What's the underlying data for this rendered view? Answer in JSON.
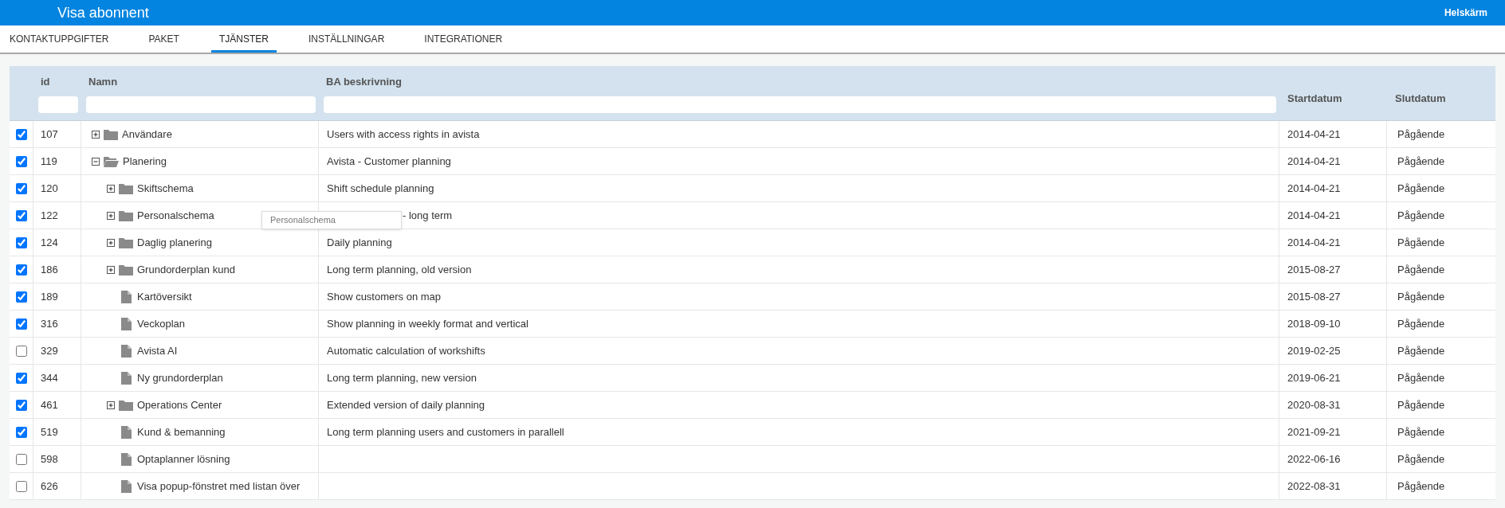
{
  "window": {
    "title": "Visa abonnent",
    "fullscreen_link": "Helskärm"
  },
  "tabs": [
    {
      "label": "KONTAKTUPPGIFTER",
      "selected": false
    },
    {
      "label": "PAKET",
      "selected": false
    },
    {
      "label": "TJÄNSTER",
      "selected": true
    },
    {
      "label": "INSTÄLLNINGAR",
      "selected": false
    },
    {
      "label": "INTEGRATIONER",
      "selected": false
    }
  ],
  "table": {
    "columns": [
      {
        "label": "id",
        "filter": true
      },
      {
        "label": "Namn",
        "filter": true
      },
      {
        "label": "BA beskrivning",
        "filter": true
      },
      {
        "label": "Startdatum",
        "filter": false
      },
      {
        "label": "Slutdatum",
        "filter": false
      }
    ],
    "rows": [
      {
        "checked": true,
        "id": "107",
        "name": "Användare",
        "kind": "folder",
        "expanded": false,
        "description": "Users with access rights in avista",
        "start": "2014-04-21",
        "end": "Pågående"
      },
      {
        "checked": true,
        "id": "119",
        "name": "Planering",
        "kind": "folder",
        "expanded": true,
        "description": "Avista - Customer planning",
        "start": "2014-04-21",
        "end": "Pågående",
        "children": [
          {
            "checked": true,
            "id": "120",
            "name": "Skiftschema",
            "kind": "folder",
            "expanded": false,
            "description": "Shift schedule planning",
            "start": "2014-04-21",
            "end": "Pågående"
          },
          {
            "checked": true,
            "id": "122",
            "name": "Personalschema",
            "kind": "folder",
            "expanded": false,
            "description": "- long term",
            "tooltip": "Personalschema",
            "start": "2014-04-21",
            "end": "Pågående"
          },
          {
            "checked": true,
            "id": "124",
            "name": "Daglig planering",
            "kind": "folder",
            "expanded": false,
            "description": "Daily planning",
            "start": "2014-04-21",
            "end": "Pågående"
          },
          {
            "checked": true,
            "id": "186",
            "name": "Grundorderplan kund",
            "kind": "folder",
            "expanded": false,
            "description": "Long term planning, old version",
            "start": "2015-08-27",
            "end": "Pågående"
          },
          {
            "checked": true,
            "id": "189",
            "name": "Kartöversikt",
            "kind": "document",
            "description": "Show customers on map",
            "start": "2015-08-27",
            "end": "Pågående"
          },
          {
            "checked": true,
            "id": "316",
            "name": "Veckoplan",
            "kind": "document",
            "description": "Show planning in weekly format and vertical",
            "start": "2018-09-10",
            "end": "Pågående"
          },
          {
            "checked": false,
            "id": "329",
            "name": "Avista AI",
            "kind": "document",
            "description": "Automatic calculation of workshifts",
            "start": "2019-02-25",
            "end": "Pågående"
          },
          {
            "checked": true,
            "id": "344",
            "name": "Ny grundorderplan",
            "kind": "document",
            "description": "Long term planning, new version",
            "start": "2019-06-21",
            "end": "Pågående"
          },
          {
            "checked": true,
            "id": "461",
            "name": "Operations Center",
            "kind": "folder",
            "expanded": false,
            "description": "Extended version of daily planning",
            "start": "2020-08-31",
            "end": "Pågående"
          },
          {
            "checked": true,
            "id": "519",
            "name": "Kund & bemanning",
            "kind": "document",
            "description": "Long term planning users and customers in parallell",
            "start": "2021-09-21",
            "end": "Pågående"
          },
          {
            "checked": false,
            "id": "598",
            "name": "Optaplanner lösning",
            "kind": "document",
            "start": "2022-06-16",
            "end": "Pågående"
          },
          {
            "checked": false,
            "id": "626",
            "name": "Visa popup-fönstret med listan över",
            "kind": "document",
            "start": "2022-08-31",
            "end": "Pågående"
          }
        ]
      }
    ]
  }
}
